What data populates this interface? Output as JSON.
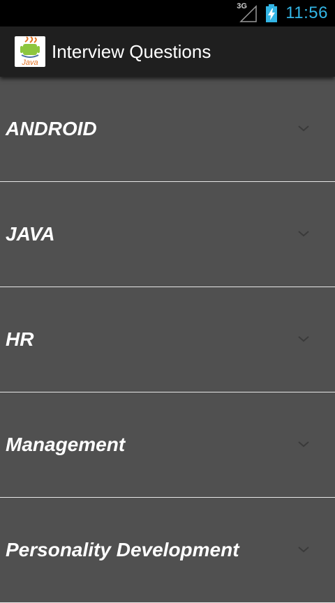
{
  "status_bar": {
    "network": "3G",
    "time": "11:56",
    "icons": [
      "signal-icon",
      "battery-charging-icon"
    ],
    "clock_color": "#33b5e5"
  },
  "action_bar": {
    "title": "Interview Questions",
    "app_icon": "java-logo-icon",
    "app_icon_text": "Java"
  },
  "list": {
    "items": [
      {
        "label": "ANDROID",
        "icon": "chevron-down-icon"
      },
      {
        "label": "JAVA",
        "icon": "chevron-down-icon"
      },
      {
        "label": "HR",
        "icon": "chevron-down-icon"
      },
      {
        "label": "Management",
        "icon": "chevron-down-icon"
      },
      {
        "label": "Personality Development",
        "icon": "chevron-down-icon"
      }
    ]
  },
  "colors": {
    "list_background": "#505050",
    "action_bar_background": "#1f1f1f",
    "divider": "#e8e8e8"
  }
}
